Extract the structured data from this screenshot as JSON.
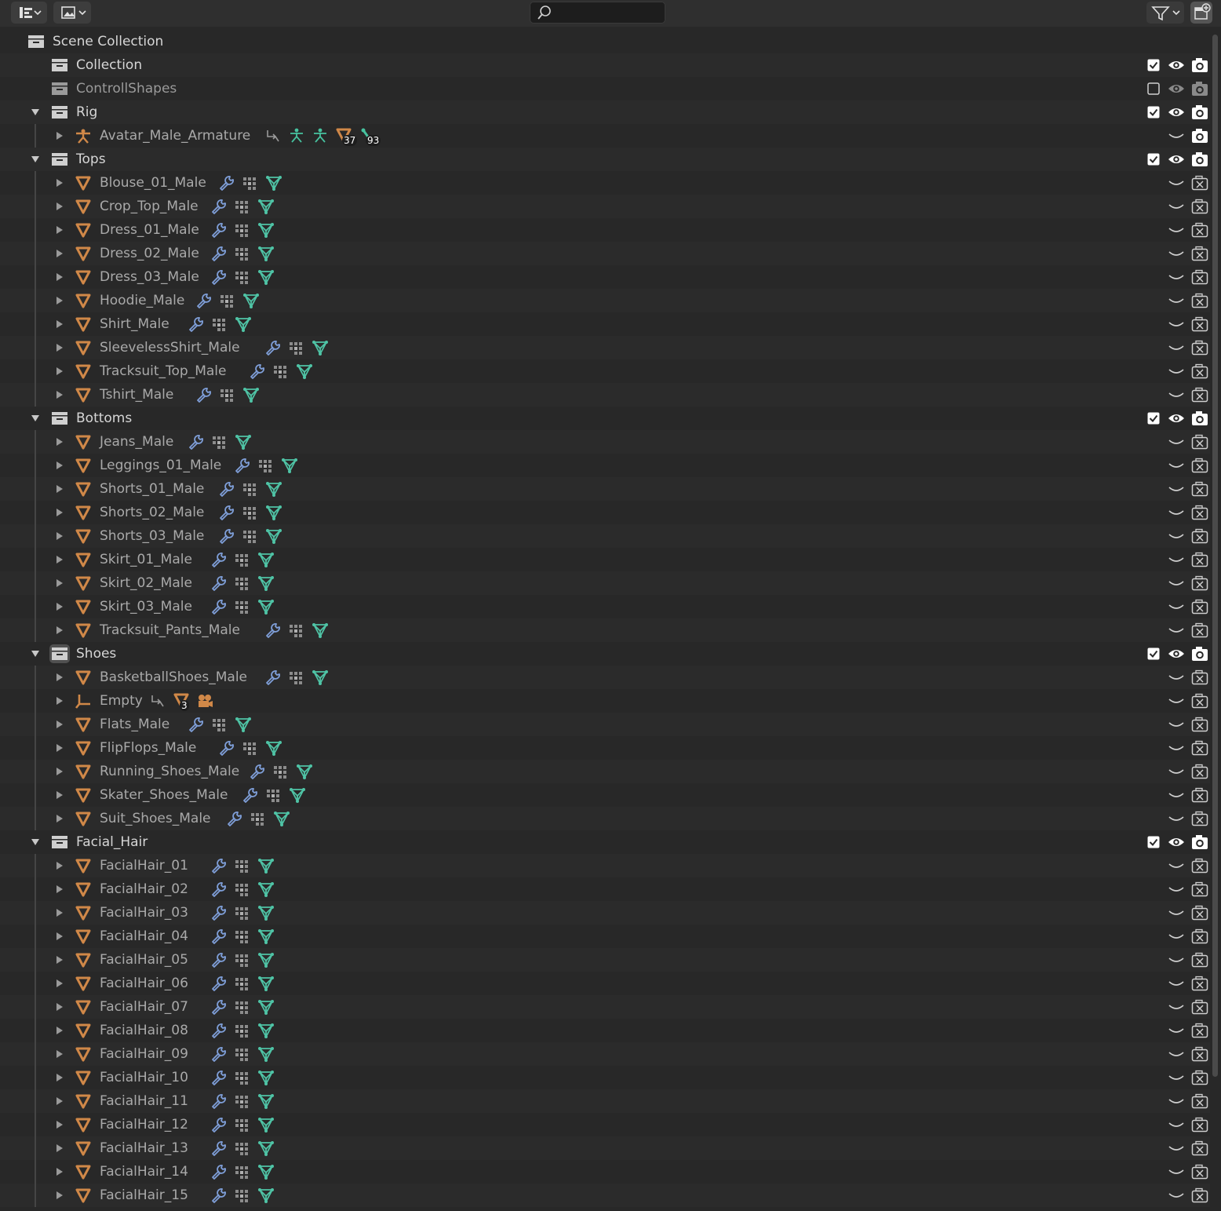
{
  "header": {
    "display_mode_icon": "outliner-view-icon",
    "view_mode_icon": "image-view-icon",
    "search_placeholder": "",
    "search_value": "",
    "filter_icon": "funnel-icon",
    "new_collection_icon": "new-collection-icon"
  },
  "colors": {
    "background": "#282828",
    "alt_row": "#2b2b2b",
    "object_orange": "#d08848",
    "modifier_blue": "#7f9fd9",
    "mesh_green": "#4fc4a6",
    "armature_green": "#47c29f"
  },
  "rows": [
    {
      "type": "scene",
      "label": "Scene Collection"
    },
    {
      "type": "collection",
      "label": "Collection",
      "checked": true
    },
    {
      "type": "collection",
      "label": "ControllShapes",
      "checked": false,
      "excluded": true
    },
    {
      "type": "collection",
      "label": "Rig",
      "checked": true,
      "expanded": true
    },
    {
      "type": "armature",
      "label": "Avatar_Male_Armature",
      "badges": [
        "37",
        "93"
      ]
    },
    {
      "type": "collection",
      "label": "Tops",
      "checked": true,
      "expanded": true
    },
    {
      "type": "mesh",
      "label": "Blouse_01_Male"
    },
    {
      "type": "mesh",
      "label": "Crop_Top_Male"
    },
    {
      "type": "mesh",
      "label": "Dress_01_Male"
    },
    {
      "type": "mesh",
      "label": "Dress_02_Male"
    },
    {
      "type": "mesh",
      "label": "Dress_03_Male"
    },
    {
      "type": "mesh",
      "label": "Hoodie_Male"
    },
    {
      "type": "mesh",
      "label": "Shirt_Male"
    },
    {
      "type": "mesh",
      "label": "SleevelessShirt_Male"
    },
    {
      "type": "mesh",
      "label": "Tracksuit_Top_Male"
    },
    {
      "type": "mesh",
      "label": "Tshirt_Male",
      "last": true
    },
    {
      "type": "collection",
      "label": "Bottoms",
      "checked": true,
      "expanded": true
    },
    {
      "type": "mesh",
      "label": "Jeans_Male"
    },
    {
      "type": "mesh",
      "label": "Leggings_01_Male"
    },
    {
      "type": "mesh",
      "label": "Shorts_01_Male"
    },
    {
      "type": "mesh",
      "label": "Shorts_02_Male"
    },
    {
      "type": "mesh",
      "label": "Shorts_03_Male"
    },
    {
      "type": "mesh",
      "label": "Skirt_01_Male"
    },
    {
      "type": "mesh",
      "label": "Skirt_02_Male"
    },
    {
      "type": "mesh",
      "label": "Skirt_03_Male"
    },
    {
      "type": "mesh",
      "label": "Tracksuit_Pants_Male",
      "last": true
    },
    {
      "type": "collection",
      "label": "Shoes",
      "checked": true,
      "expanded": true,
      "active": true
    },
    {
      "type": "mesh",
      "label": "BasketballShoes_Male"
    },
    {
      "type": "empty",
      "label": "Empty",
      "badges": [
        "3"
      ]
    },
    {
      "type": "mesh",
      "label": "Flats_Male"
    },
    {
      "type": "mesh",
      "label": "FlipFlops_Male"
    },
    {
      "type": "mesh",
      "label": "Running_Shoes_Male"
    },
    {
      "type": "mesh",
      "label": "Skater_Shoes_Male"
    },
    {
      "type": "mesh",
      "label": "Suit_Shoes_Male",
      "last": true
    },
    {
      "type": "collection",
      "label": "Facial_Hair",
      "checked": true,
      "expanded": true
    },
    {
      "type": "mesh",
      "label": "FacialHair_01"
    },
    {
      "type": "mesh",
      "label": "FacialHair_02"
    },
    {
      "type": "mesh",
      "label": "FacialHair_03"
    },
    {
      "type": "mesh",
      "label": "FacialHair_04"
    },
    {
      "type": "mesh",
      "label": "FacialHair_05"
    },
    {
      "type": "mesh",
      "label": "FacialHair_06"
    },
    {
      "type": "mesh",
      "label": "FacialHair_07"
    },
    {
      "type": "mesh",
      "label": "FacialHair_08"
    },
    {
      "type": "mesh",
      "label": "FacialHair_09"
    },
    {
      "type": "mesh",
      "label": "FacialHair_10"
    },
    {
      "type": "mesh",
      "label": "FacialHair_11"
    },
    {
      "type": "mesh",
      "label": "FacialHair_12"
    },
    {
      "type": "mesh",
      "label": "FacialHair_13"
    },
    {
      "type": "mesh",
      "label": "FacialHair_14"
    },
    {
      "type": "mesh",
      "label": "FacialHair_15"
    }
  ]
}
